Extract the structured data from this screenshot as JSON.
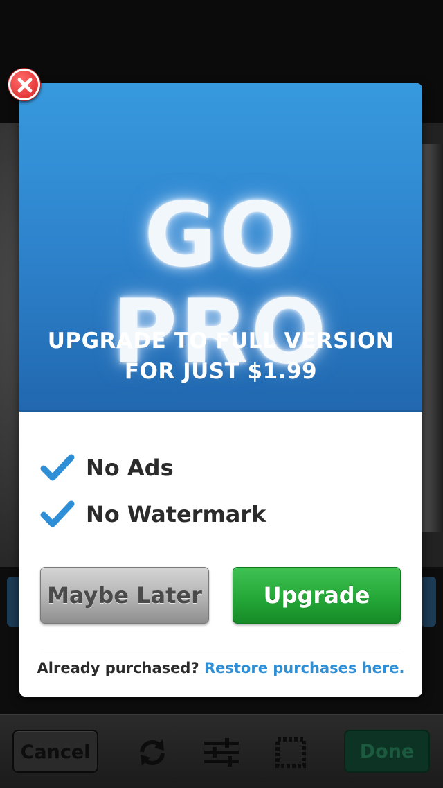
{
  "toolbar": {
    "cancel_label": "Cancel",
    "done_label": "Done",
    "icons": [
      "rotate-icon",
      "adjust-sliders-icon",
      "frame-border-icon"
    ]
  },
  "modal": {
    "hero_title": "GO PRO",
    "headline_line1": "UPGRADE TO FULL VERSION",
    "headline_line2": "FOR JUST $1.99",
    "features": [
      {
        "label": "No Ads"
      },
      {
        "label": "No Watermark"
      }
    ],
    "maybe_later_label": "Maybe Later",
    "upgrade_label": "Upgrade",
    "footer_text": "Already purchased? ",
    "footer_link": "Restore purchases here.",
    "close_icon": "close-icon"
  },
  "colors": {
    "hero_blue": "#2f86cf",
    "upgrade_green": "#25a838",
    "link_blue": "#2f8fd6",
    "close_red": "#e63b3b"
  }
}
